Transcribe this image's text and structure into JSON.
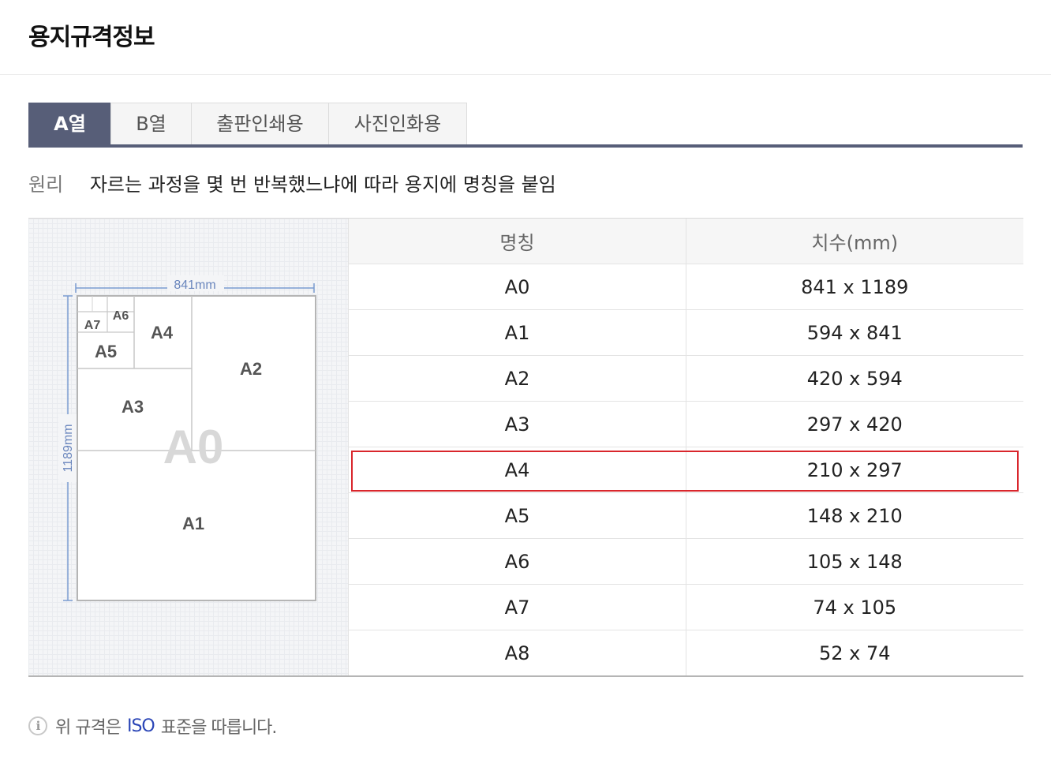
{
  "header": {
    "title": "용지규격정보"
  },
  "tabs": [
    {
      "label": "A열",
      "active": true
    },
    {
      "label": "B열",
      "active": false
    },
    {
      "label": "출판인쇄용",
      "active": false
    },
    {
      "label": "사진인화용",
      "active": false
    }
  ],
  "principle": {
    "label": "원리",
    "text": "자르는 과정을 몇 번 반복했느냐에 따라 용지에 명칭을 붙임"
  },
  "diagram": {
    "width_label": "841mm",
    "height_label": "1189mm",
    "labels": {
      "a0": "A0",
      "a1": "A1",
      "a2": "A2",
      "a3": "A3",
      "a4": "A4",
      "a5": "A5",
      "a6": "A6",
      "a7": "A7"
    }
  },
  "table": {
    "headers": [
      "명칭",
      "치수(mm)"
    ],
    "rows": [
      {
        "name": "A0",
        "size": "841 x 1189"
      },
      {
        "name": "A1",
        "size": "594 x 841"
      },
      {
        "name": "A2",
        "size": "420 x 594"
      },
      {
        "name": "A3",
        "size": "297 x 420"
      },
      {
        "name": "A4",
        "size": "210 x 297"
      },
      {
        "name": "A5",
        "size": "148 x 210"
      },
      {
        "name": "A6",
        "size": "105 x 148"
      },
      {
        "name": "A7",
        "size": "74 x 105"
      },
      {
        "name": "A8",
        "size": "52 x 74"
      }
    ],
    "highlighted_row": "A4"
  },
  "footnote": {
    "prefix": "위 규격은",
    "link": "ISO",
    "suffix": "표준을 따릅니다."
  },
  "colors": {
    "tab_active": "#575e78",
    "highlight": "#d9262c",
    "iso_link": "#2b46b7"
  }
}
